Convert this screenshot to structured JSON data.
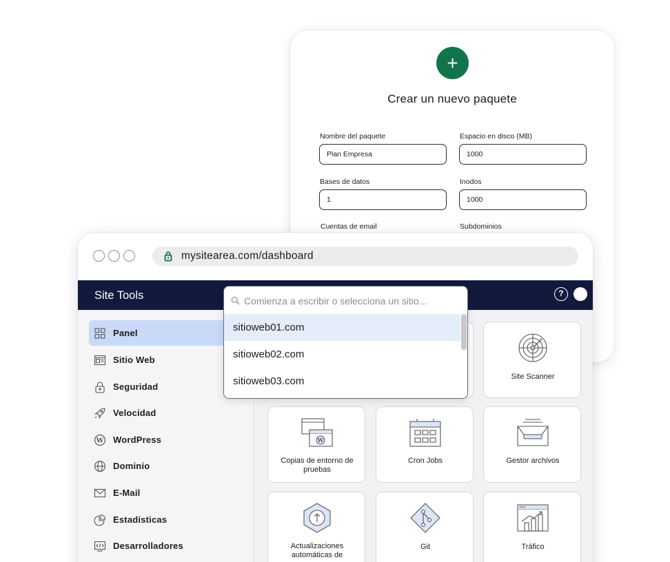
{
  "package_form": {
    "title": "Crear un nuevo paquete",
    "add_icon": "plus-icon",
    "fields": [
      {
        "label": "Nombre del paquete",
        "value": "Plan Empresa"
      },
      {
        "label": "Espacio en disco (MB)",
        "value": "1000"
      },
      {
        "label": "Bases de datos",
        "value": "1"
      },
      {
        "label": "Inodos",
        "value": "1000"
      },
      {
        "label": "Cuentas de email",
        "value": ""
      },
      {
        "label": "Subdominios",
        "value": ""
      }
    ],
    "accent_color": "#12744a"
  },
  "browser": {
    "url": "mysitearea.com/dashboard",
    "lock_icon": "lock-icon"
  },
  "appbar": {
    "title": "Site Tools",
    "help_icon": "question-icon",
    "background": "#111a3d"
  },
  "sidebar": {
    "items": [
      {
        "label": "Panel",
        "icon": "grid-icon",
        "active": true
      },
      {
        "label": "Sitio Web",
        "icon": "website-icon"
      },
      {
        "label": "Seguridad",
        "icon": "lock-icon"
      },
      {
        "label": "Velocidad",
        "icon": "rocket-icon"
      },
      {
        "label": "WordPress",
        "icon": "wordpress-icon"
      },
      {
        "label": "Dominio",
        "icon": "globe-icon"
      },
      {
        "label": "E-Mail",
        "icon": "envelope-icon"
      },
      {
        "label": "Estadísticas",
        "icon": "pie-chart-icon"
      },
      {
        "label": "Desarrolladores",
        "icon": "code-icon"
      }
    ]
  },
  "tiles": [
    {
      "label": "Site Scanner",
      "icon": "radar-icon"
    },
    {
      "label": "Copias de entorno de pruebas",
      "icon": "staging-icon"
    },
    {
      "label": "Cron Jobs",
      "icon": "calendar-icon"
    },
    {
      "label": "Gestor archivos",
      "icon": "file-tray-icon"
    },
    {
      "label": "Actualizaciones automáticas de",
      "icon": "update-arrow-icon"
    },
    {
      "label": "Git",
      "icon": "git-icon"
    },
    {
      "label": "Tráfico",
      "icon": "traffic-chart-icon"
    }
  ],
  "site_dropdown": {
    "placeholder": "Comienza a escribir o selecciona un sitio...",
    "options": [
      "sitioweb01.com",
      "sitioweb02.com",
      "sitioweb03.com"
    ],
    "highlight_color": "#e5edfb"
  }
}
